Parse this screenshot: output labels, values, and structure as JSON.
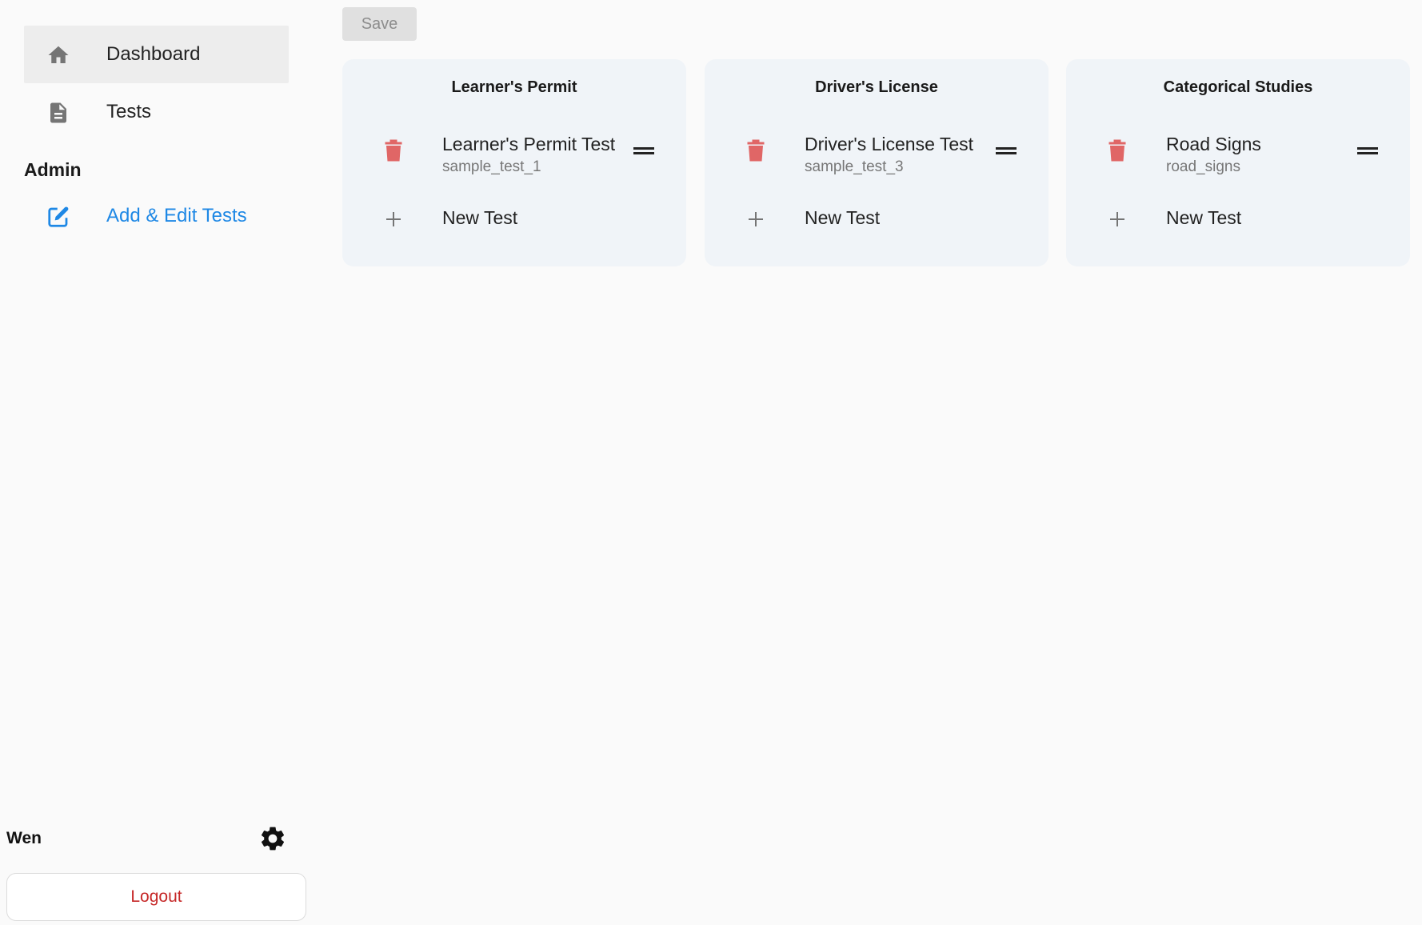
{
  "sidebar": {
    "nav": [
      {
        "label": "Dashboard",
        "icon": "home-icon",
        "active": true
      },
      {
        "label": "Tests",
        "icon": "document-icon",
        "active": false
      }
    ],
    "admin_title": "Admin",
    "admin_link": {
      "label": "Add & Edit Tests",
      "icon": "edit-icon"
    },
    "user": {
      "name": "Wen",
      "logout_label": "Logout"
    }
  },
  "toolbar": {
    "save_label": "Save"
  },
  "categories": [
    {
      "title": "Learner's Permit",
      "tests": [
        {
          "name": "Learner's Permit Test",
          "slug": "sample_test_1"
        }
      ],
      "new_label": "New Test"
    },
    {
      "title": "Driver's License",
      "tests": [
        {
          "name": "Driver's License Test",
          "slug": "sample_test_3"
        }
      ],
      "new_label": "New Test"
    },
    {
      "title": "Categorical Studies",
      "tests": [
        {
          "name": "Road Signs",
          "slug": "road_signs"
        }
      ],
      "new_label": "New Test"
    }
  ],
  "colors": {
    "accent": "#1e88e5",
    "danger": "#e06666",
    "logout": "#c62828",
    "card_bg": "#f0f4f8"
  }
}
